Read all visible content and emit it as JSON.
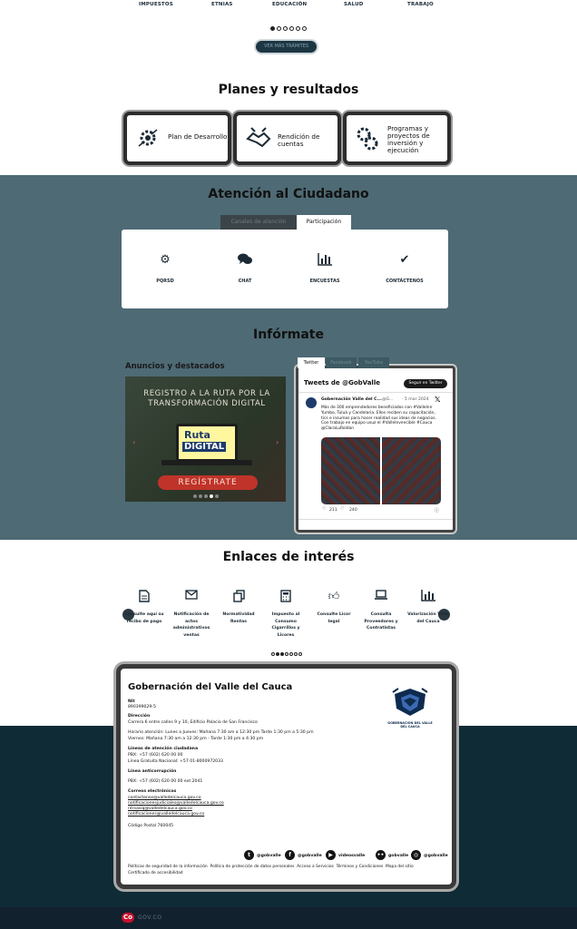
{
  "top_nav": {
    "items": [
      "IMPUESTOS",
      "ETNIAS",
      "EDUCACIÓN",
      "SALUD",
      "TRABAJO"
    ]
  },
  "carousel": {
    "see_all": "VER MÁS TRÁMITES"
  },
  "plans": {
    "title": "Planes y resultados",
    "items": [
      {
        "label": "Plan de Desarrollo",
        "icon": "strategy-gear-icon"
      },
      {
        "label": "Rendición de cuentas",
        "icon": "handshake-icon"
      },
      {
        "label": "Programas y proyectos de inversión y ejecución",
        "icon": "gears-icon"
      }
    ]
  },
  "attention": {
    "title": "Atención al Ciudadano",
    "tabs": [
      "Canales de atención",
      "Participación"
    ],
    "items": [
      {
        "label": "PQRSD",
        "icon": "gear-icon"
      },
      {
        "label": "CHAT",
        "icon": "chat-icon"
      },
      {
        "label": "ENCUESTAS",
        "icon": "bar-chart-icon"
      },
      {
        "label": "CONTÁCTENOS",
        "icon": "check-icon"
      }
    ]
  },
  "informate": {
    "title": "Infórmate",
    "announcements_title": "Anuncios y destacados",
    "banner": {
      "headline": "REGISTRO A LA RUTA POR LA TRANSFORMACIÓN DIGITAL",
      "ruta": "Ruta",
      "digital": "DIGITAL",
      "cta": "REGÍSTRATE"
    },
    "widget": {
      "tabs": [
        "Twitter",
        "Facebook",
        "YouTube"
      ],
      "header": "Tweets de @GobValle",
      "follow": "Seguir en Twitter",
      "tweet_author": "Gobernación Valle del C...",
      "tweet_handle": "@G...",
      "tweet_date": "· 5 mar 2024",
      "tweet_text": "Más de 300 emprendedores beneficiados con #ValleInn Yumbo, Tuluá y Candelaria. Ellos reciben su capacitación, tics e insumos para hacer realidad sus ideas de negocios. Con trabajo en equipo usuz el #ValleInvencible #Cauca @ClaraLuRoldan",
      "replies": "211",
      "likes": "240"
    }
  },
  "links": {
    "title": "Enlaces de interés",
    "items": [
      {
        "label": "Consulte aquí su recibo de pago",
        "icon": "document-icon"
      },
      {
        "label": "Notificación de actos administrativos ventas",
        "icon": "mail-icon"
      },
      {
        "label": "Normatividad Rentas",
        "icon": "copy-icon"
      },
      {
        "label": "Impuesto al Consumo Cigarrillos y Licores",
        "icon": "calculator-icon"
      },
      {
        "label": "Consulte Licor legal",
        "icon": "thumbs-up-icon"
      },
      {
        "label": "Consulta Proveedores y Contratistas",
        "icon": "laptop-icon"
      },
      {
        "label": "Valorización Valle del Cauca",
        "icon": "bar-chart-icon"
      }
    ]
  },
  "footer": {
    "title": "Gobernación del Valle del Cauca",
    "nit_label": "Nit",
    "nit": "890399029-5",
    "address_label": "Dirección",
    "address": "Carrera 6 entre calles 9 y 10, Edificio Palacio de San Francisco",
    "hours_1": "Horario atención: Lunes a Jueves: Mañana 7:30 am a 12:30 pm Tarde 1:30 pm a 5:30 pm",
    "hours_2": "Viernes: Mañana 7:30 am a 12:30 pm - Tarde 1:30 pm a 4:30 pm",
    "lines_label": "Líneas de atención ciudadana",
    "pbx": "PBX: +57 (602) 620 00 00",
    "free_line": "Línea Gratuita Nacional: +57 01-8000972033",
    "anticorruption_label": "Línea anticorrupción",
    "anticorruption": "PBX: +57 (602) 620 00 00 ext 2041",
    "emails_label": "Correos electrónicos",
    "emails": [
      "contactenos@valledelcauca.gov.co",
      "notificacionesjudiciales@valledelcauca.gov.co",
      "ntrsasiq@valledelcauca.gov.co",
      "notificaciones@valledelcauca.gov.co"
    ],
    "postal": "Código Postal 760045",
    "logo_text": "GOBERNACIÓN DEL VALLE DEL CAUCA",
    "socials": [
      {
        "label": "@gobvalle",
        "icon": "twitter-icon",
        "glyph": "t"
      },
      {
        "label": "@gobvalle",
        "icon": "facebook-icon",
        "glyph": "f"
      },
      {
        "label": "videosvalle",
        "icon": "youtube-icon",
        "glyph": "▶"
      },
      {
        "label": "gobvalle",
        "icon": "flickr-icon",
        "glyph": "••"
      },
      {
        "label": "@gobvalle",
        "icon": "instagram-icon",
        "glyph": "◎"
      }
    ],
    "legal_links": [
      "Políticas de seguridad de la información",
      "Política de protección de datos personales",
      "Acceso a Servicios",
      "Términos y Condiciones",
      "Mapa del sitio",
      "Certificado de accesibilidad"
    ]
  },
  "bottom_bar": {
    "brand": "Co",
    "text": "GOV.CO"
  },
  "colors": {
    "band": "#4e6a74",
    "footer": "#0e2b36",
    "accent": "#1d3644"
  }
}
